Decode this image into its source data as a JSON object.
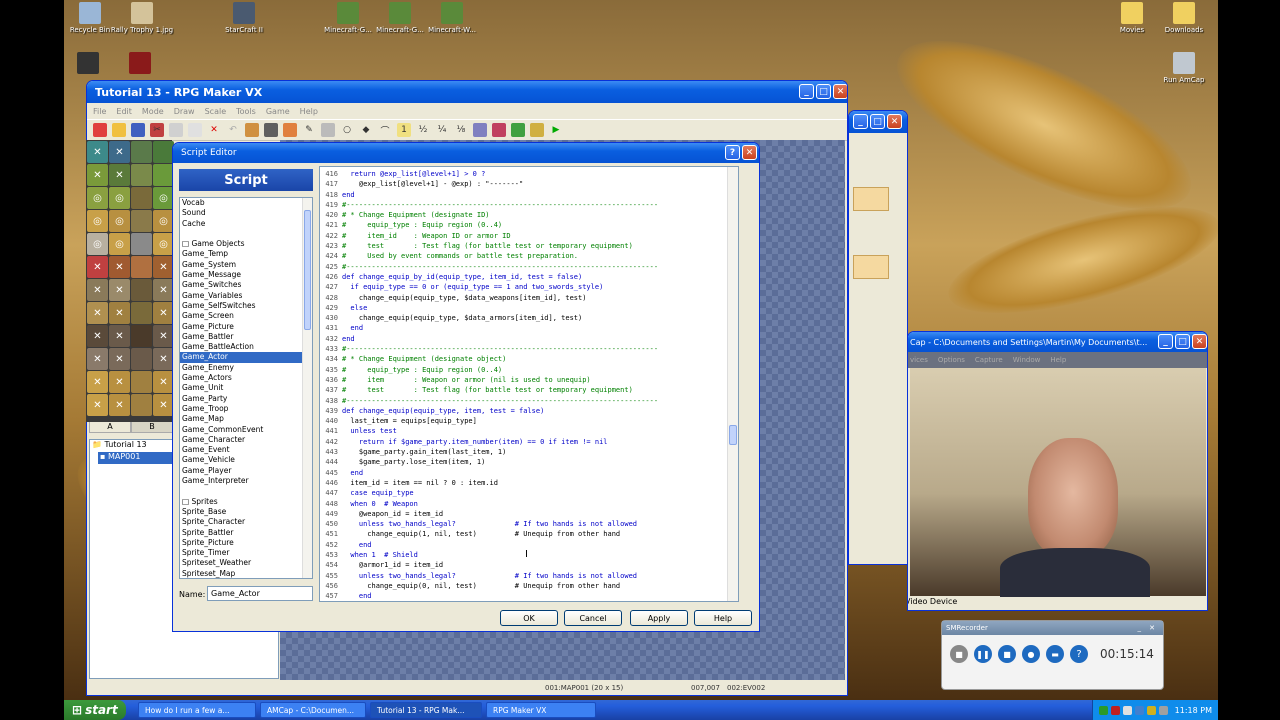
{
  "desktop": {
    "icons": [
      {
        "label": "Recycle Bin",
        "icon": "recycle-bin-icon"
      },
      {
        "label": "Rally Trophy 1.jpg",
        "icon": "image-icon"
      },
      {
        "label": "StarCraft II",
        "icon": "game-icon"
      },
      {
        "label": "Minecraft-G...",
        "icon": "minecraft-icon"
      },
      {
        "label": "Minecraft-G...",
        "icon": "minecraft-icon"
      },
      {
        "label": "Minecraft-W...",
        "icon": "minecraft-icon"
      },
      {
        "label": "Movies",
        "icon": "folder-icon"
      },
      {
        "label": "Downloads",
        "icon": "folder-icon"
      },
      {
        "label": "Run AmCap",
        "icon": "camera-icon"
      }
    ]
  },
  "rpgmaker": {
    "title": "Tutorial 13 - RPG Maker VX",
    "menus": [
      "File",
      "Edit",
      "Mode",
      "Draw",
      "Scale",
      "Tools",
      "Game",
      "Help"
    ],
    "map_tabs": [
      "A",
      "B"
    ],
    "tree": [
      "Tutorial 13",
      "MAP001"
    ],
    "status": [
      "001:MAP001 (20 x 15)",
      "007,007",
      "002:EV002"
    ]
  },
  "script_editor": {
    "title": "Script Editor",
    "list_header": "Script",
    "list_items": [
      "Vocab",
      "Sound",
      "Cache",
      "",
      "□ Game Objects",
      "Game_Temp",
      "Game_System",
      "Game_Message",
      "Game_Switches",
      "Game_Variables",
      "Game_SelfSwitches",
      "Game_Screen",
      "Game_Picture",
      "Game_Battler",
      "Game_BattleAction",
      "Game_Actor",
      "Game_Enemy",
      "Game_Actors",
      "Game_Unit",
      "Game_Party",
      "Game_Troop",
      "Game_Map",
      "Game_CommonEvent",
      "Game_Character",
      "Game_Event",
      "Game_Vehicle",
      "Game_Player",
      "Game_Interpreter",
      "",
      "□ Sprites",
      "Sprite_Base",
      "Sprite_Character",
      "Sprite_Battler",
      "Sprite_Picture",
      "Sprite_Timer",
      "Spriteset_Weather",
      "Spriteset_Map"
    ],
    "selected_index": 15,
    "name_label": "Name:",
    "name_value": "Game_Actor",
    "buttons": {
      "ok": "OK",
      "cancel": "Cancel",
      "apply": "Apply",
      "help": "Help"
    },
    "code": [
      {
        "n": "416",
        "t": "  return @exp_list[@level+1] > 0 ?",
        "c": "kw"
      },
      {
        "n": "417",
        "t": "    @exp_list[@level+1] - @exp) : \"-------\"",
        "c": ""
      },
      {
        "n": "418",
        "t": "end",
        "c": "kw"
      },
      {
        "n": "419",
        "t": "#--------------------------------------------------------------------------",
        "c": "cm"
      },
      {
        "n": "420",
        "t": "# * Change Equipment (designate ID)",
        "c": "cm"
      },
      {
        "n": "421",
        "t": "#     equip_type : Equip region (0..4)",
        "c": "cm"
      },
      {
        "n": "422",
        "t": "#     item_id    : Weapon ID or armor ID",
        "c": "cm"
      },
      {
        "n": "423",
        "t": "#     test       : Test flag (for battle test or temporary equipment)",
        "c": "cm"
      },
      {
        "n": "424",
        "t": "#     Used by event commands or battle test preparation.",
        "c": "cm"
      },
      {
        "n": "425",
        "t": "#--------------------------------------------------------------------------",
        "c": "cm"
      },
      {
        "n": "426",
        "t": "def change_equip_by_id(equip_type, item_id, test = false)",
        "c": "kw"
      },
      {
        "n": "427",
        "t": "  if equip_type == 0 or (equip_type == 1 and two_swords_style)",
        "c": "kw"
      },
      {
        "n": "428",
        "t": "    change_equip(equip_type, $data_weapons[item_id], test)",
        "c": ""
      },
      {
        "n": "429",
        "t": "  else",
        "c": "kw"
      },
      {
        "n": "430",
        "t": "    change_equip(equip_type, $data_armors[item_id], test)",
        "c": ""
      },
      {
        "n": "431",
        "t": "  end",
        "c": "kw"
      },
      {
        "n": "432",
        "t": "end",
        "c": "kw"
      },
      {
        "n": "433",
        "t": "#--------------------------------------------------------------------------",
        "c": "cm"
      },
      {
        "n": "434",
        "t": "# * Change Equipment (designate object)",
        "c": "cm"
      },
      {
        "n": "435",
        "t": "#     equip_type : Equip region (0..4)",
        "c": "cm"
      },
      {
        "n": "436",
        "t": "#     item       : Weapon or armor (nil is used to unequip)",
        "c": "cm"
      },
      {
        "n": "437",
        "t": "#     test       : Test flag (for battle test or temporary equipment)",
        "c": "cm"
      },
      {
        "n": "438",
        "t": "#--------------------------------------------------------------------------",
        "c": "cm"
      },
      {
        "n": "439",
        "t": "def change_equip(equip_type, item, test = false)",
        "c": "kw"
      },
      {
        "n": "440",
        "t": "  last_item = equips[equip_type]",
        "c": ""
      },
      {
        "n": "441",
        "t": "  unless test",
        "c": "kw"
      },
      {
        "n": "442",
        "t": "    return if $game_party.item_number(item) == 0 if item != nil",
        "c": "kw"
      },
      {
        "n": "443",
        "t": "    $game_party.gain_item(last_item, 1)",
        "c": ""
      },
      {
        "n": "444",
        "t": "    $game_party.lose_item(item, 1)",
        "c": ""
      },
      {
        "n": "445",
        "t": "  end",
        "c": "kw"
      },
      {
        "n": "446",
        "t": "  item_id = item == nil ? 0 : item.id",
        "c": ""
      },
      {
        "n": "447",
        "t": "  case equip_type",
        "c": "kw"
      },
      {
        "n": "448",
        "t": "  when 0  # Weapon",
        "c": "kw"
      },
      {
        "n": "449",
        "t": "    @weapon_id = item_id",
        "c": ""
      },
      {
        "n": "450",
        "t": "    unless two_hands_legal?              # If two hands is not allowed",
        "c": "kw"
      },
      {
        "n": "451",
        "t": "      change_equip(1, nil, test)         # Unequip from other hand",
        "c": ""
      },
      {
        "n": "452",
        "t": "    end",
        "c": "kw"
      },
      {
        "n": "453",
        "t": "  when 1  # Shield",
        "c": "kw"
      },
      {
        "n": "454",
        "t": "    @armor1_id = item_id",
        "c": ""
      },
      {
        "n": "455",
        "t": "    unless two_hands_legal?              # If two hands is not allowed",
        "c": "kw"
      },
      {
        "n": "456",
        "t": "      change_equip(0, nil, test)         # Unequip from other hand",
        "c": ""
      },
      {
        "n": "457",
        "t": "    end",
        "c": "kw"
      }
    ]
  },
  "amcap": {
    "title": "Cap - C:\\Documents and Settings\\Martin\\My Documents\\t...",
    "menus": [
      "vices",
      "Options",
      "Capture",
      "Window",
      "Help"
    ],
    "status": "USB Video Device"
  },
  "recorder": {
    "title": "SMRecorder",
    "time": "00:15:14"
  },
  "taskbar": {
    "start": "start",
    "tasks": [
      "How do I run a few a...",
      "AMCap - C:\\Documen...",
      "Tutorial 13 - RPG Mak...",
      "RPG Maker VX"
    ],
    "active_index": 2,
    "clock": "11:18 PM"
  },
  "colors": {
    "titlebar": "#0653d4",
    "selection": "#316ac5",
    "taskbar": "#245edb",
    "start": "#3c9a3c"
  }
}
